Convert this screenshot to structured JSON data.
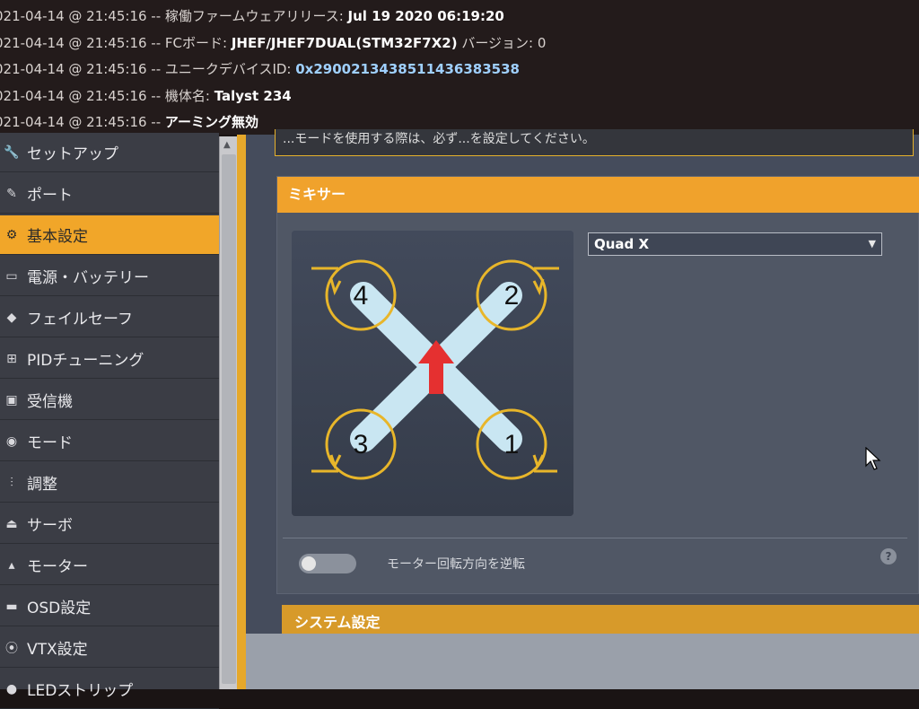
{
  "log": [
    {
      "prefix": "021-04-14 @ 21:45:16 -- 稼働ファームウェアリリース: ",
      "value": "Jul 19 2020 06:19:20",
      "suffix": ""
    },
    {
      "prefix": "021-04-14 @ 21:45:16 -- FCボード: ",
      "value": "JHEF/JHEF7DUAL(STM32F7X2)",
      "suffix": " バージョン: 0"
    },
    {
      "prefix": "021-04-14 @ 21:45:16 -- ユニークデバイスID: ",
      "value": "0x290021343851143638353​8",
      "suffix": ""
    },
    {
      "prefix": "021-04-14 @ 21:45:16 -- 機体名: ",
      "value": "Talyst 234",
      "suffix": ""
    },
    {
      "prefix": "021-04-14 @ 21:45:16 -- ",
      "value": "アーミング無効",
      "suffix": ""
    }
  ],
  "sidebar": {
    "items": [
      {
        "label": "セットアップ",
        "icon": "wrench-icon",
        "glyph": "🔧",
        "active": false
      },
      {
        "label": "ポート",
        "icon": "plug-icon",
        "glyph": "✎",
        "active": false
      },
      {
        "label": "基本設定",
        "icon": "gear-icon",
        "glyph": "⚙",
        "active": true
      },
      {
        "label": "電源・バッテリー",
        "icon": "battery-icon",
        "glyph": "▭",
        "active": false
      },
      {
        "label": "フェイルセーフ",
        "icon": "diamond-icon",
        "glyph": "◆",
        "active": false
      },
      {
        "label": "PIDチューニング",
        "icon": "network-icon",
        "glyph": "⊞",
        "active": false
      },
      {
        "label": "受信機",
        "icon": "receiver-icon",
        "glyph": "▣",
        "active": false
      },
      {
        "label": "モード",
        "icon": "toggle-icon",
        "glyph": "◉",
        "active": false
      },
      {
        "label": "調整",
        "icon": "sliders-icon",
        "glyph": "⫶",
        "active": false
      },
      {
        "label": "サーボ",
        "icon": "servo-icon",
        "glyph": "⏏",
        "active": false
      },
      {
        "label": "モーター",
        "icon": "motor-icon",
        "glyph": "▴",
        "active": false
      },
      {
        "label": "OSD設定",
        "icon": "osd-icon",
        "glyph": "▬",
        "active": false
      },
      {
        "label": "VTX設定",
        "icon": "antenna-icon",
        "glyph": "⦿",
        "active": false
      },
      {
        "label": "LEDストリップ",
        "icon": "bulb-icon",
        "glyph": "●",
        "active": false
      }
    ]
  },
  "notice": "...モードを使用する際は、必ず...を設定してください。",
  "mixer": {
    "title": "ミキサー",
    "selected": "Quad X",
    "motors": [
      "4",
      "2",
      "3",
      "1"
    ],
    "reverse_label": "モーター回転方向を逆転",
    "reverse_on": false,
    "help": "?"
  },
  "system": {
    "title": "システム設定"
  },
  "colors": {
    "accent": "#f0a22c",
    "motor_ring": "#e8b62a",
    "arrow": "#e53030"
  }
}
